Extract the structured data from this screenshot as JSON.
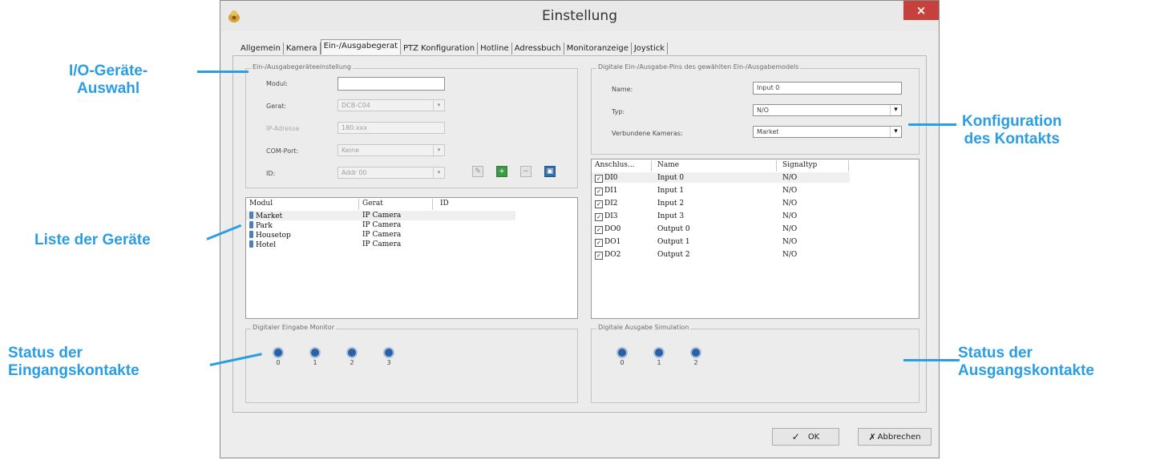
{
  "window": {
    "title": "Einstellung",
    "close_label": "×"
  },
  "tabs": [
    "Allgemein",
    "Kamera",
    "Ein-/Ausgabegerat",
    "PTZ Konfiguration",
    "Hotline",
    "Adressbuch",
    "Monitoranzeige",
    "Joystick"
  ],
  "device_settings": {
    "title": "Ein-/Ausgabegeräteeinstellung",
    "modul_label": "Modul:",
    "modul_value": "",
    "gerat_label": "Gerat:",
    "gerat_value": "DCB-C04",
    "ip_label": "IP-Adresse",
    "ip_value": "180.xxx",
    "com_label": "COM-Port:",
    "com_value": "Keine",
    "id_label": "ID:",
    "id_value": "Addr 00"
  },
  "device_list": {
    "headers": [
      "Modul",
      "Gerat",
      "ID"
    ],
    "rows": [
      {
        "modul": "Market",
        "gerat": "IP Camera",
        "id": ""
      },
      {
        "modul": "Park",
        "gerat": "IP Camera",
        "id": ""
      },
      {
        "modul": "Housetop",
        "gerat": "IP Camera",
        "id": ""
      },
      {
        "modul": "Hotel",
        "gerat": "IP Camera",
        "id": ""
      }
    ]
  },
  "input_monitor": {
    "title": "Digitaler Eingabe Monitor",
    "leds": [
      "0",
      "1",
      "2",
      "3"
    ]
  },
  "pin_config": {
    "title": "Digitale Ein-/Ausgabe-Pins des gewählten Ein-/Ausgabemodels",
    "name_label": "Name:",
    "name_value": "Input 0",
    "typ_label": "Typ:",
    "typ_value": "N/O",
    "cam_label": "Verbundene Kameras:",
    "cam_value": "Market"
  },
  "pin_list": {
    "headers": [
      "Anschlus...",
      "Name",
      "Signaltyp"
    ],
    "rows": [
      {
        "pin": "DI0",
        "name": "Input 0",
        "type": "N/O"
      },
      {
        "pin": "DI1",
        "name": "Input 1",
        "type": "N/O"
      },
      {
        "pin": "DI2",
        "name": "Input 2",
        "type": "N/O"
      },
      {
        "pin": "DI3",
        "name": "Input 3",
        "type": "N/O"
      },
      {
        "pin": "DO0",
        "name": "Output 0",
        "type": "N/O"
      },
      {
        "pin": "DO1",
        "name": "Output 1",
        "type": "N/O"
      },
      {
        "pin": "DO2",
        "name": "Output 2",
        "type": "N/O"
      }
    ]
  },
  "output_sim": {
    "title": "Digitale Ausgabe Simulation",
    "leds": [
      "0",
      "1",
      "2"
    ]
  },
  "buttons": {
    "ok": "OK",
    "cancel": "Abbrechen"
  },
  "annotations": {
    "io_selection": [
      "I/O-Geräte-",
      "Auswahl"
    ],
    "device_list": "Liste der Geräte",
    "input_status": [
      "Status der",
      "Eingangskontakte"
    ],
    "contact_config": [
      "Konfiguration",
      "des Kontakts"
    ],
    "output_status": [
      "Status der",
      "Ausgangskontakte"
    ]
  },
  "colors": {
    "annotation": "#2b9de3",
    "close": "#c7413c"
  }
}
